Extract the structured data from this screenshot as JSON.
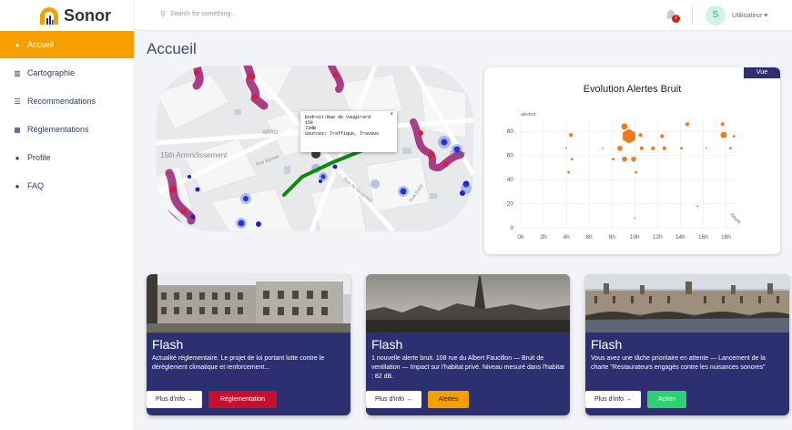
{
  "app": {
    "name": "Sonor"
  },
  "sidebar": {
    "items": [
      {
        "label": "Accueil",
        "icon": "user-icon",
        "active": true
      },
      {
        "label": "Cartographie",
        "icon": "map-icon"
      },
      {
        "label": "Recommendations",
        "icon": "list-icon"
      },
      {
        "label": "Réglementations",
        "icon": "table-icon"
      },
      {
        "label": "Profile",
        "icon": "user-icon"
      },
      {
        "label": "FAQ",
        "icon": "info-icon"
      }
    ]
  },
  "header": {
    "search_placeholder": "Search for something...",
    "notifications_count": "2",
    "avatar_letter": "S",
    "user_label": "Utilisateur ▾"
  },
  "page": {
    "title": "Accueil"
  },
  "map": {
    "district_label": "15th Arrondissement",
    "popup": {
      "line1": "Endroit:Rue de Vaugirard",
      "line2": "15é",
      "line3": "73dB",
      "line4": "Sources: Traffique, Travaux",
      "close": "×"
    },
    "street_labels": [
      "ARRO",
      "Rue Blomet",
      "Rue de Vaugirard",
      "Rue Dutot",
      "Rue Ro"
    ]
  },
  "chart_card": {
    "badge": "Vue"
  },
  "chart_data": {
    "type": "scatter",
    "title": "Evolution Alertes Bruit",
    "ylabel": "alertes",
    "xlabel": "heure",
    "xlim": [
      0,
      19
    ],
    "ylim": [
      0,
      90
    ],
    "x_ticks": [
      "0h",
      "2h",
      "4h",
      "6h",
      "8h",
      "10h",
      "12h",
      "14h",
      "16h",
      "18h"
    ],
    "y_ticks": [
      0,
      20,
      40,
      60,
      80
    ],
    "grid": true,
    "series": [
      {
        "color": "#f07a1e",
        "points": [
          {
            "x": 4.2,
            "y": 46,
            "size": 2
          },
          {
            "x": 4.5,
            "y": 57,
            "size": 2
          },
          {
            "x": 4.4,
            "y": 77,
            "size": 3
          },
          {
            "x": 8.1,
            "y": 57,
            "size": 2
          },
          {
            "x": 8.7,
            "y": 66,
            "size": 4
          },
          {
            "x": 9.1,
            "y": 84,
            "size": 5
          },
          {
            "x": 9.5,
            "y": 76,
            "size": 8
          },
          {
            "x": 9.1,
            "y": 57,
            "size": 4
          },
          {
            "x": 9.9,
            "y": 57,
            "size": 4
          },
          {
            "x": 10.5,
            "y": 77,
            "size": 3
          },
          {
            "x": 10.6,
            "y": 66,
            "size": 3
          },
          {
            "x": 11.6,
            "y": 66,
            "size": 3
          },
          {
            "x": 12.4,
            "y": 76,
            "size": 3
          },
          {
            "x": 12.6,
            "y": 66,
            "size": 3
          },
          {
            "x": 14.6,
            "y": 86,
            "size": 3
          },
          {
            "x": 14.1,
            "y": 66,
            "size": 2
          },
          {
            "x": 17.7,
            "y": 86,
            "size": 3
          },
          {
            "x": 17.8,
            "y": 77,
            "size": 5
          },
          {
            "x": 18.7,
            "y": 76,
            "size": 2
          },
          {
            "x": 18.4,
            "y": 66,
            "size": 2
          },
          {
            "x": 10.1,
            "y": 46,
            "size": 2
          },
          {
            "x": 7.2,
            "y": 66,
            "size": 1
          },
          {
            "x": 15.5,
            "y": 18,
            "size": 1
          },
          {
            "x": 10.0,
            "y": 8,
            "size": 1
          },
          {
            "x": 4.0,
            "y": 66,
            "size": 1
          },
          {
            "x": 16.3,
            "y": 66,
            "size": 1
          }
        ]
      }
    ]
  },
  "cards": [
    {
      "title": "Flash",
      "text": "Actualité réglementaire. Le projet de loi portant lutte contre le dérèglement climatique et renforcement...",
      "info_button": "Plus d'info →",
      "action_button": "Réglementation",
      "action_color": "#c8102e"
    },
    {
      "title": "Flash",
      "text": "1 nouvelle alerte bruit. 108 rue du Albert Faucillon — Bruit de ventilation — Impact sur l'habitat privé. Niveau mesuré dans l'habitat : 82 dB.",
      "info_button": "Plus d'info →",
      "action_button": "Alertes",
      "action_color": "#f5a000"
    },
    {
      "title": "Flash",
      "text": "Vous avez une tâche prioritaire en attente — Lancement de la charte \"Restaurateurs engagés contre les nuisances sonores\"",
      "info_button": "Plus d'info →",
      "action_button": "Action",
      "action_color": "#2fcf73"
    }
  ]
}
